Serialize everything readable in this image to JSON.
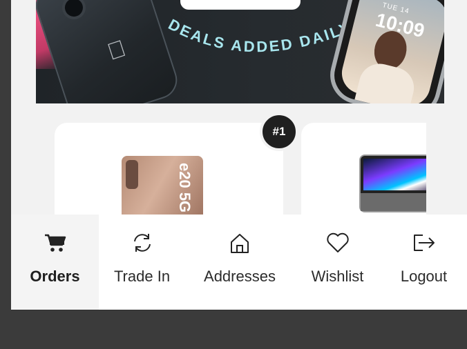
{
  "hero": {
    "headline": "DEALS ADDED DAILY",
    "watch_date": "TUE 14",
    "watch_time": "10:09"
  },
  "products": [
    {
      "rank": "#1",
      "thumb_text": "e20 5G"
    },
    {
      "rank": "",
      "thumb_text": ""
    }
  ],
  "tabs": [
    {
      "id": "orders",
      "label": "Orders",
      "icon": "cart-icon",
      "active": true
    },
    {
      "id": "trade-in",
      "label": "Trade In",
      "icon": "refresh-icon",
      "active": false
    },
    {
      "id": "addresses",
      "label": "Addresses",
      "icon": "home-icon",
      "active": false
    },
    {
      "id": "wishlist",
      "label": "Wishlist",
      "icon": "heart-icon",
      "active": false
    },
    {
      "id": "logout",
      "label": "Logout",
      "icon": "logout-icon",
      "active": false
    }
  ],
  "colors": {
    "accent_text": "#a8e6ee",
    "backdrop": "#3b3b3b",
    "active_tab_bg": "#f4f4f4"
  }
}
